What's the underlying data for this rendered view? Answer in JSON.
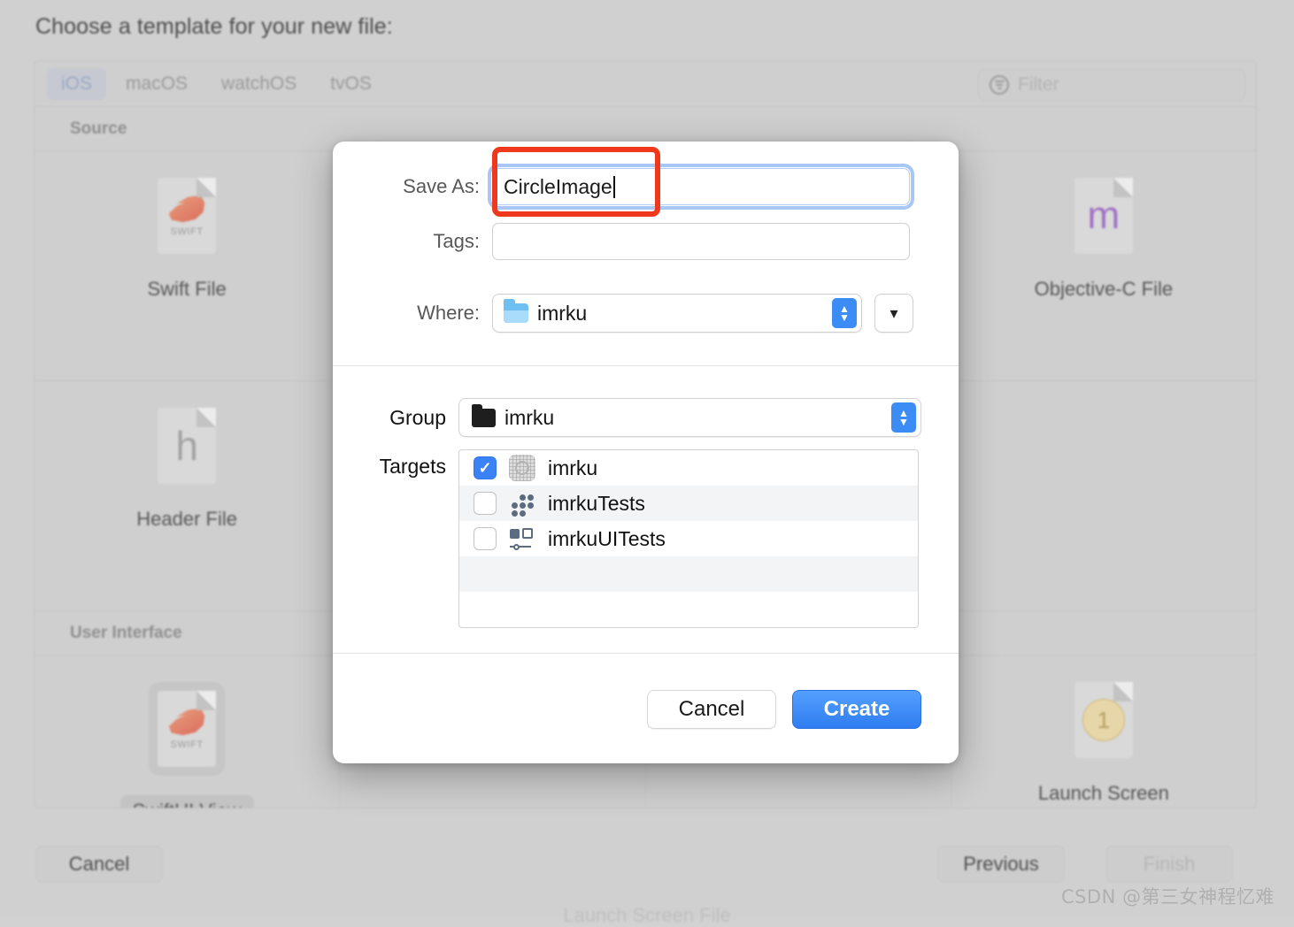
{
  "background": {
    "title": "Choose a template for your new file:",
    "tabs": [
      {
        "label": "iOS",
        "active": true
      },
      {
        "label": "macOS",
        "active": false
      },
      {
        "label": "watchOS",
        "active": false
      },
      {
        "label": "tvOS",
        "active": false
      }
    ],
    "filter": {
      "placeholder": "Filter",
      "icon": "filter-icon"
    },
    "sections": [
      {
        "heading": "Source",
        "items": [
          {
            "label": "Swift File",
            "icon": "swift-file-icon",
            "selected": false
          },
          {
            "label": "",
            "icon": "cocoa-touch-class-icon",
            "selected": false
          },
          {
            "label": "",
            "icon": "ui-test-case-class-icon",
            "selected": false
          },
          {
            "label": "Objective-C File",
            "icon": "objective-c-file-icon",
            "selected": false
          }
        ]
      },
      {
        "heading": "User Interface",
        "items": [
          {
            "label": "SwiftUI View",
            "icon": "swift-file-icon",
            "selected": true
          },
          {
            "label": "",
            "icon": "storyboard-icon",
            "selected": false
          },
          {
            "label": "",
            "icon": "view-icon",
            "selected": false
          },
          {
            "label": "Launch Screen",
            "icon": "launch-screen-icon",
            "selected": false
          }
        ]
      }
    ],
    "second_row_partial_labels": {
      "left": "Header File",
      "right": "Launch Screen File"
    },
    "footer": {
      "cancel": "Cancel",
      "previous": "Previous",
      "finish": "Finish"
    }
  },
  "sheet": {
    "save_as": {
      "label": "Save As:",
      "value": "CircleImage"
    },
    "tags": {
      "label": "Tags:",
      "value": ""
    },
    "where": {
      "label": "Where:",
      "value": "imrku",
      "icon": "blue-folder-icon"
    },
    "group": {
      "label": "Group",
      "value": "imrku",
      "icon": "dark-folder-icon"
    },
    "targets": {
      "label": "Targets",
      "items": [
        {
          "name": "imrku",
          "checked": true,
          "icon": "app-target-icon"
        },
        {
          "name": "imrkuTests",
          "checked": false,
          "icon": "unit-test-target-icon"
        },
        {
          "name": "imrkuUITests",
          "checked": false,
          "icon": "ui-test-target-icon"
        }
      ]
    },
    "buttons": {
      "cancel": "Cancel",
      "create": "Create"
    }
  },
  "annotation": {
    "color": "#f0381c",
    "target": "save-as-input"
  },
  "watermark": {
    "text": "CSDN @第三女神程忆难"
  }
}
